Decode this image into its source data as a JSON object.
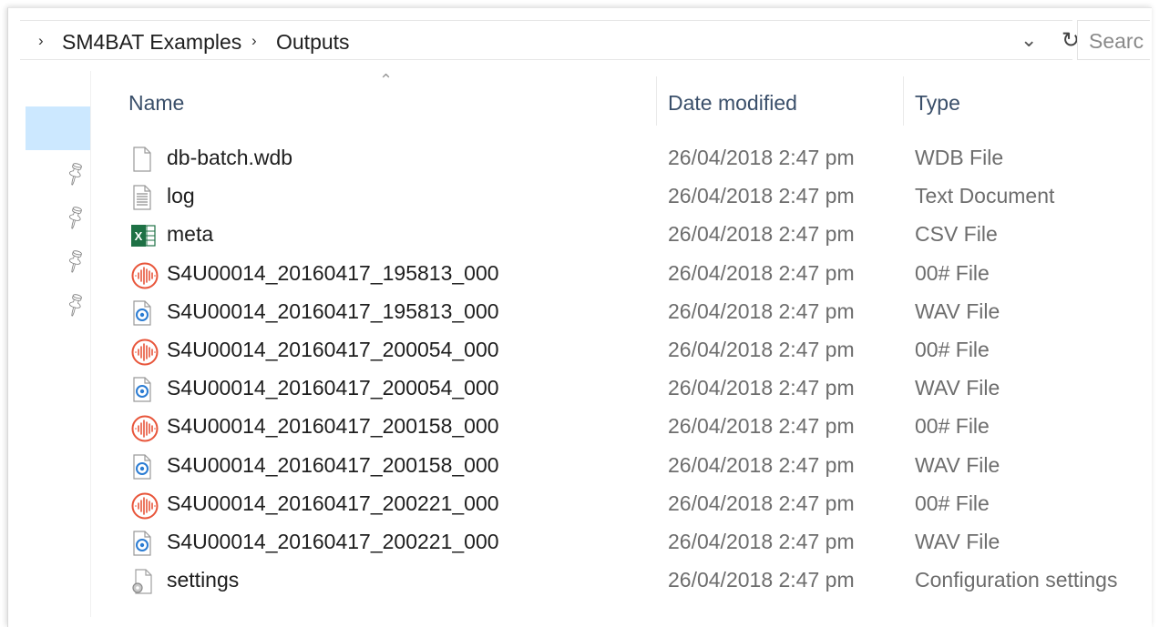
{
  "breadcrumb": {
    "items": [
      "SM4BAT Examples",
      "Outputs"
    ]
  },
  "search": {
    "placeholder": "Searc"
  },
  "columns": {
    "name": "Name",
    "date_modified": "Date modified",
    "type": "Type"
  },
  "files": [
    {
      "name": "db-batch.wdb",
      "date": "26/04/2018 2:47 pm",
      "type": "WDB File",
      "icon": "blank-file-icon"
    },
    {
      "name": "log",
      "date": "26/04/2018 2:47 pm",
      "type": "Text Document",
      "icon": "text-document-icon"
    },
    {
      "name": "meta",
      "date": "26/04/2018 2:47 pm",
      "type": "CSV File",
      "icon": "excel-icon"
    },
    {
      "name": "S4U00014_20160417_195813_000",
      "date": "26/04/2018 2:47 pm",
      "type": "00# File",
      "icon": "waveform-icon"
    },
    {
      "name": "S4U00014_20160417_195813_000",
      "date": "26/04/2018 2:47 pm",
      "type": "WAV File",
      "icon": "wav-file-icon"
    },
    {
      "name": "S4U00014_20160417_200054_000",
      "date": "26/04/2018 2:47 pm",
      "type": "00# File",
      "icon": "waveform-icon"
    },
    {
      "name": "S4U00014_20160417_200054_000",
      "date": "26/04/2018 2:47 pm",
      "type": "WAV File",
      "icon": "wav-file-icon"
    },
    {
      "name": "S4U00014_20160417_200158_000",
      "date": "26/04/2018 2:47 pm",
      "type": "00# File",
      "icon": "waveform-icon"
    },
    {
      "name": "S4U00014_20160417_200158_000",
      "date": "26/04/2018 2:47 pm",
      "type": "WAV File",
      "icon": "wav-file-icon"
    },
    {
      "name": "S4U00014_20160417_200221_000",
      "date": "26/04/2018 2:47 pm",
      "type": "00# File",
      "icon": "waveform-icon"
    },
    {
      "name": "S4U00014_20160417_200221_000",
      "date": "26/04/2018 2:47 pm",
      "type": "WAV File",
      "icon": "wav-file-icon"
    },
    {
      "name": "settings",
      "date": "26/04/2018 2:47 pm",
      "type": "Configuration settings",
      "icon": "settings-file-icon"
    }
  ],
  "colors": {
    "selection": "#cce8ff",
    "header_text": "#3a4f6a",
    "excel_green": "#1e7145",
    "waveform_red": "#e8553a",
    "wav_blue": "#2b7cd3"
  }
}
